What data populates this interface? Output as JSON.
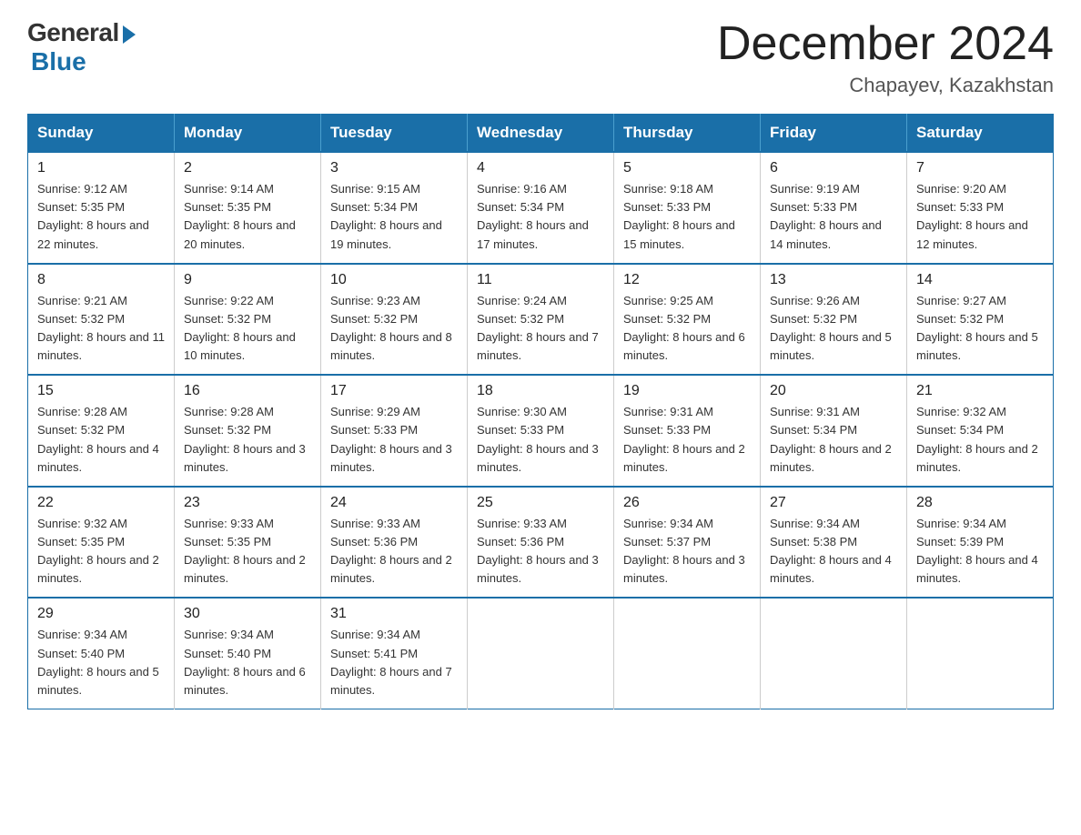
{
  "header": {
    "logo_general": "General",
    "logo_blue": "Blue",
    "month_year": "December 2024",
    "location": "Chapayev, Kazakhstan"
  },
  "calendar": {
    "days_of_week": [
      "Sunday",
      "Monday",
      "Tuesday",
      "Wednesday",
      "Thursday",
      "Friday",
      "Saturday"
    ],
    "weeks": [
      [
        {
          "day": "1",
          "sunrise": "9:12 AM",
          "sunset": "5:35 PM",
          "daylight": "8 hours and 22 minutes."
        },
        {
          "day": "2",
          "sunrise": "9:14 AM",
          "sunset": "5:35 PM",
          "daylight": "8 hours and 20 minutes."
        },
        {
          "day": "3",
          "sunrise": "9:15 AM",
          "sunset": "5:34 PM",
          "daylight": "8 hours and 19 minutes."
        },
        {
          "day": "4",
          "sunrise": "9:16 AM",
          "sunset": "5:34 PM",
          "daylight": "8 hours and 17 minutes."
        },
        {
          "day": "5",
          "sunrise": "9:18 AM",
          "sunset": "5:33 PM",
          "daylight": "8 hours and 15 minutes."
        },
        {
          "day": "6",
          "sunrise": "9:19 AM",
          "sunset": "5:33 PM",
          "daylight": "8 hours and 14 minutes."
        },
        {
          "day": "7",
          "sunrise": "9:20 AM",
          "sunset": "5:33 PM",
          "daylight": "8 hours and 12 minutes."
        }
      ],
      [
        {
          "day": "8",
          "sunrise": "9:21 AM",
          "sunset": "5:32 PM",
          "daylight": "8 hours and 11 minutes."
        },
        {
          "day": "9",
          "sunrise": "9:22 AM",
          "sunset": "5:32 PM",
          "daylight": "8 hours and 10 minutes."
        },
        {
          "day": "10",
          "sunrise": "9:23 AM",
          "sunset": "5:32 PM",
          "daylight": "8 hours and 8 minutes."
        },
        {
          "day": "11",
          "sunrise": "9:24 AM",
          "sunset": "5:32 PM",
          "daylight": "8 hours and 7 minutes."
        },
        {
          "day": "12",
          "sunrise": "9:25 AM",
          "sunset": "5:32 PM",
          "daylight": "8 hours and 6 minutes."
        },
        {
          "day": "13",
          "sunrise": "9:26 AM",
          "sunset": "5:32 PM",
          "daylight": "8 hours and 5 minutes."
        },
        {
          "day": "14",
          "sunrise": "9:27 AM",
          "sunset": "5:32 PM",
          "daylight": "8 hours and 5 minutes."
        }
      ],
      [
        {
          "day": "15",
          "sunrise": "9:28 AM",
          "sunset": "5:32 PM",
          "daylight": "8 hours and 4 minutes."
        },
        {
          "day": "16",
          "sunrise": "9:28 AM",
          "sunset": "5:32 PM",
          "daylight": "8 hours and 3 minutes."
        },
        {
          "day": "17",
          "sunrise": "9:29 AM",
          "sunset": "5:33 PM",
          "daylight": "8 hours and 3 minutes."
        },
        {
          "day": "18",
          "sunrise": "9:30 AM",
          "sunset": "5:33 PM",
          "daylight": "8 hours and 3 minutes."
        },
        {
          "day": "19",
          "sunrise": "9:31 AM",
          "sunset": "5:33 PM",
          "daylight": "8 hours and 2 minutes."
        },
        {
          "day": "20",
          "sunrise": "9:31 AM",
          "sunset": "5:34 PM",
          "daylight": "8 hours and 2 minutes."
        },
        {
          "day": "21",
          "sunrise": "9:32 AM",
          "sunset": "5:34 PM",
          "daylight": "8 hours and 2 minutes."
        }
      ],
      [
        {
          "day": "22",
          "sunrise": "9:32 AM",
          "sunset": "5:35 PM",
          "daylight": "8 hours and 2 minutes."
        },
        {
          "day": "23",
          "sunrise": "9:33 AM",
          "sunset": "5:35 PM",
          "daylight": "8 hours and 2 minutes."
        },
        {
          "day": "24",
          "sunrise": "9:33 AM",
          "sunset": "5:36 PM",
          "daylight": "8 hours and 2 minutes."
        },
        {
          "day": "25",
          "sunrise": "9:33 AM",
          "sunset": "5:36 PM",
          "daylight": "8 hours and 3 minutes."
        },
        {
          "day": "26",
          "sunrise": "9:34 AM",
          "sunset": "5:37 PM",
          "daylight": "8 hours and 3 minutes."
        },
        {
          "day": "27",
          "sunrise": "9:34 AM",
          "sunset": "5:38 PM",
          "daylight": "8 hours and 4 minutes."
        },
        {
          "day": "28",
          "sunrise": "9:34 AM",
          "sunset": "5:39 PM",
          "daylight": "8 hours and 4 minutes."
        }
      ],
      [
        {
          "day": "29",
          "sunrise": "9:34 AM",
          "sunset": "5:40 PM",
          "daylight": "8 hours and 5 minutes."
        },
        {
          "day": "30",
          "sunrise": "9:34 AM",
          "sunset": "5:40 PM",
          "daylight": "8 hours and 6 minutes."
        },
        {
          "day": "31",
          "sunrise": "9:34 AM",
          "sunset": "5:41 PM",
          "daylight": "8 hours and 7 minutes."
        },
        null,
        null,
        null,
        null
      ]
    ]
  }
}
